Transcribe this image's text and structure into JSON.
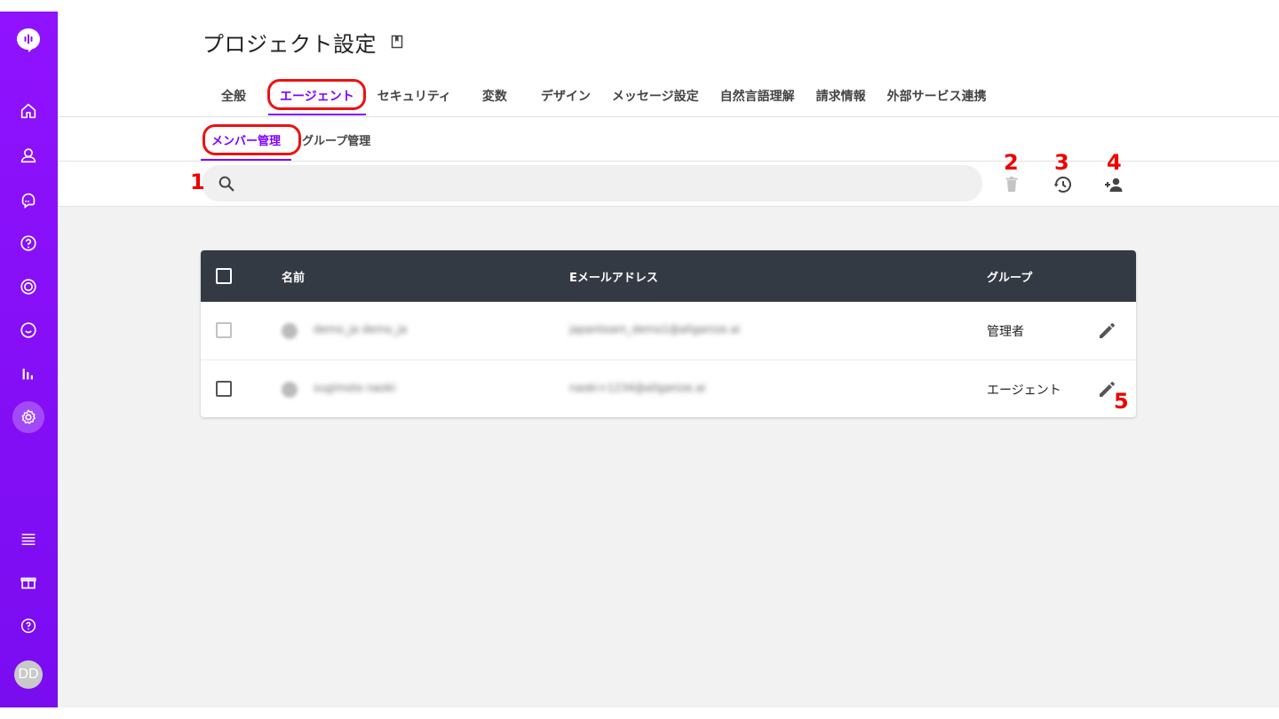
{
  "page": {
    "title": "プロジェクト設定"
  },
  "tabs": [
    {
      "label": "全般"
    },
    {
      "label": "エージェント"
    },
    {
      "label": "セキュリティ"
    },
    {
      "label": "変数"
    },
    {
      "label": "デザイン"
    },
    {
      "label": "メッセージ設定"
    },
    {
      "label": "自然言語理解"
    },
    {
      "label": "請求情報"
    },
    {
      "label": "外部サービス連携"
    }
  ],
  "active_tab": "エージェント",
  "subtabs": [
    {
      "label": "メンバー管理"
    },
    {
      "label": "グループ管理"
    }
  ],
  "active_subtab": "メンバー管理",
  "search": {
    "value": "",
    "placeholder": ""
  },
  "table": {
    "columns": {
      "name": "名前",
      "email": "Eメールアドレス",
      "group": "グループ"
    },
    "rows": [
      {
        "name": "demo_ja demo_ja",
        "email": "japanteam_demo1@allganize.ai",
        "group": "管理者"
      },
      {
        "name": "sugimoto naoki",
        "email": "naoki+1234@allganize.ai",
        "group": "エージェント"
      }
    ]
  },
  "annotations": {
    "n1": "1",
    "n2": "2",
    "n3": "3",
    "n4": "4",
    "n5": "5",
    "color": "#ee0000"
  },
  "user": {
    "initials": "DD"
  },
  "colors": {
    "accent": "#7f00ff",
    "sidebar": "#8a10fa",
    "table_header": "#343a43"
  }
}
